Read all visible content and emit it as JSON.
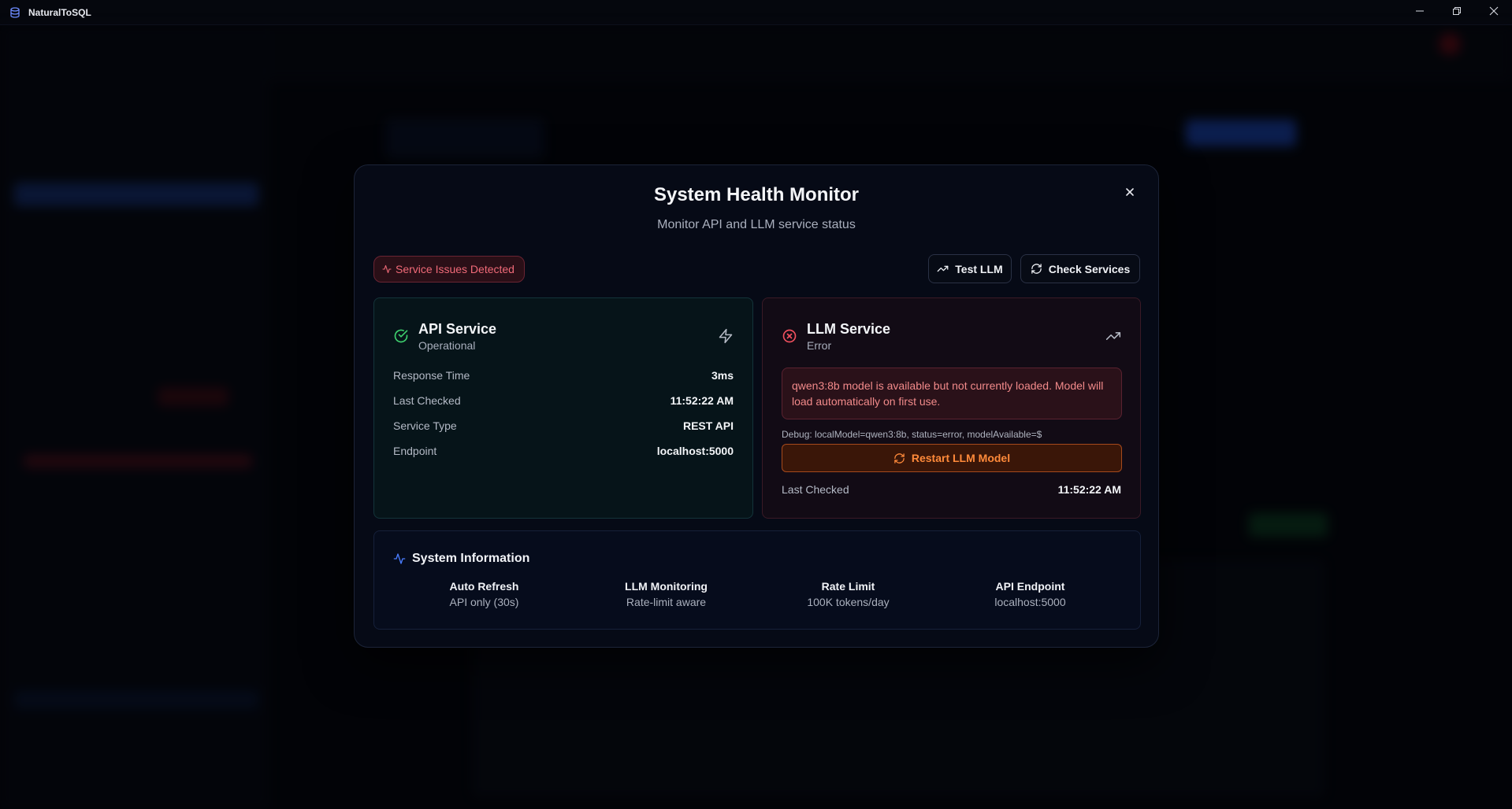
{
  "window": {
    "title": "NaturalToSQL",
    "app_icon": "database-icon",
    "controls": [
      "minimize-icon",
      "restore-icon",
      "close-icon"
    ]
  },
  "modal": {
    "title": "System Health Monitor",
    "subtitle": "Monitor API and LLM service status",
    "status_badge": "Service Issues Detected",
    "test_llm_label": "Test LLM",
    "check_services_label": "Check Services"
  },
  "api_service": {
    "name": "API Service",
    "state": "Operational",
    "rows": [
      {
        "label": "Response Time",
        "value": "3ms"
      },
      {
        "label": "Last Checked",
        "value": "11:52:22 AM"
      },
      {
        "label": "Service Type",
        "value": "REST API"
      },
      {
        "label": "Endpoint",
        "value": "localhost:5000"
      }
    ]
  },
  "llm_service": {
    "name": "LLM Service",
    "state": "Error",
    "error_message": "qwen3:8b model is available but not currently loaded. Model will load automatically on first use.",
    "debug": "Debug: localModel=qwen3:8b, status=error, modelAvailable=$",
    "restart_label": "Restart LLM Model",
    "last_checked_label": "Last Checked",
    "last_checked_value": "11:52:22 AM"
  },
  "system_info": {
    "title": "System Information",
    "items": [
      {
        "label": "Auto Refresh",
        "value": "API only (30s)"
      },
      {
        "label": "LLM Monitoring",
        "value": "Rate-limit aware"
      },
      {
        "label": "Rate Limit",
        "value": "100K tokens/day"
      },
      {
        "label": "API Endpoint",
        "value": "localhost:5000"
      }
    ]
  },
  "colors": {
    "success": "#3ecf6e",
    "error": "#f0505e",
    "warning": "#ff8a3a",
    "accent": "#4a7dff"
  }
}
